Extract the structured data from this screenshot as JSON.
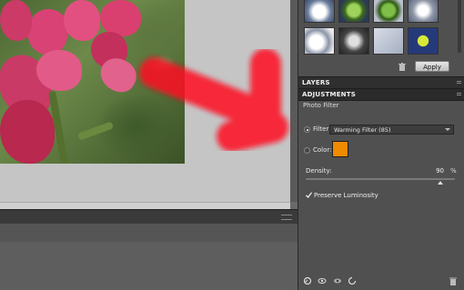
{
  "right_panel": {
    "apply_label": "Apply",
    "layers_title": "LAYERS",
    "adjustments_title": "ADJUSTMENTS",
    "section_title": "Photo Filter",
    "filter_label": "Filter:",
    "filter_value": "Warming Filter (85)",
    "color_label": "Color:",
    "color_value": "#f08a00",
    "density_label": "Density:",
    "density_value": "90",
    "density_unit": "%",
    "density_fraction": 0.9,
    "preserve_label": "Preserve Luminosity",
    "preserve_checked": true
  },
  "icons": {
    "trash": "trash-icon",
    "eye": "eye-icon",
    "clip": "clip-to-layer-icon",
    "reset": "reset-icon",
    "visibility": "visibility-icon",
    "delete": "delete-icon"
  },
  "colors": {
    "arrow": "#ff1020",
    "panel_bg": "#505050",
    "header_bg": "#2f2f2f"
  }
}
